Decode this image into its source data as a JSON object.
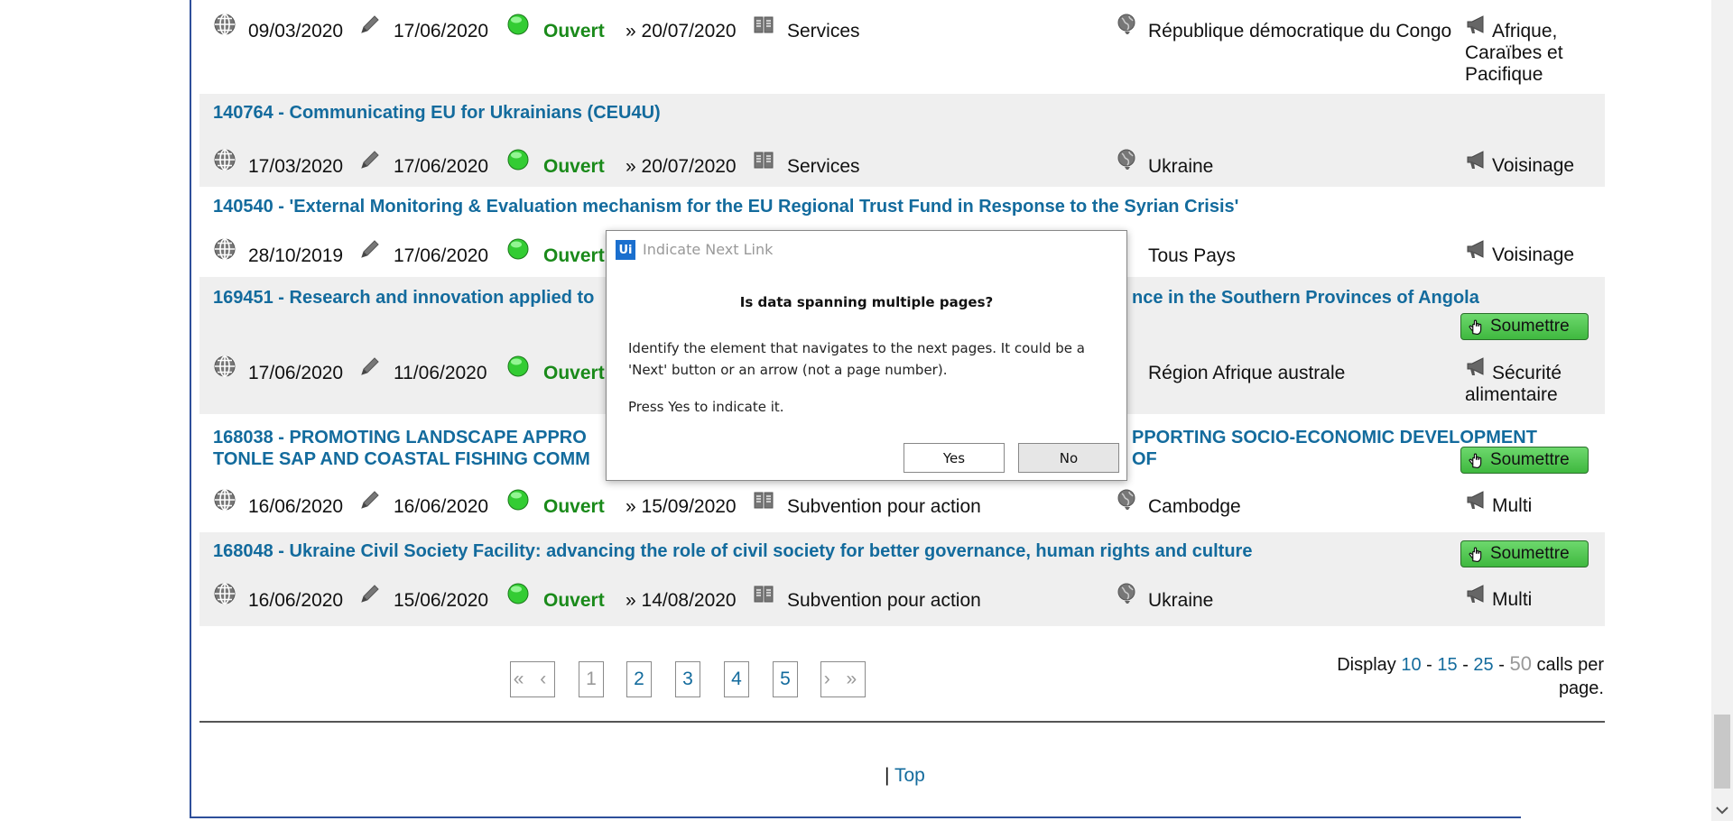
{
  "rows": [
    {
      "title": "",
      "published": "09/03/2020",
      "updated": "17/06/2020",
      "status": "Ouvert",
      "deadline": "» 20/07/2020",
      "type": "Services",
      "country": "République démocratique du Congo",
      "region": "Afrique, Caraïbes et Pacifique",
      "submit": ""
    },
    {
      "title": "140764 - Communicating EU for Ukrainians (CEU4U)",
      "published": "17/03/2020",
      "updated": "17/06/2020",
      "status": "Ouvert",
      "deadline": "» 20/07/2020",
      "type": "Services",
      "country": "Ukraine",
      "region": "Voisinage",
      "submit": ""
    },
    {
      "title": "140540 - 'External Monitoring & Evaluation mechanism for the EU Regional Trust Fund in Response to the Syrian Crisis'",
      "published": "28/10/2019",
      "updated": "17/06/2020",
      "status": "Ouvert",
      "deadline": "",
      "type": "",
      "country": "Tous Pays",
      "region": "Voisinage",
      "submit": ""
    },
    {
      "title": "169451 - Research and innovation applied to",
      "title_right": "nce in the Southern Provinces of Angola",
      "published": "17/06/2020",
      "updated": "11/06/2020",
      "status": "Ouvert",
      "deadline": "",
      "type": "",
      "country": "Région Afrique australe",
      "region": "Sécurité alimentaire",
      "submit": "Soumettre"
    },
    {
      "title": "168038 - PROMOTING LANDSCAPE APPRO",
      "title_line2": "TONLE SAP AND COASTAL FISHING COMM",
      "title_right": "PPORTING SOCIO-ECONOMIC DEVELOPMENT OF",
      "published": "16/06/2020",
      "updated": "16/06/2020",
      "status": "Ouvert",
      "deadline": "» 15/09/2020",
      "type": "Subvention pour action",
      "country": "Cambodge",
      "region": "Multi",
      "submit": "Soumettre"
    },
    {
      "title": "168048 - Ukraine Civil Society Facility: advancing the role of civil society for better governance, human rights and culture",
      "published": "16/06/2020",
      "updated": "15/06/2020",
      "status": "Ouvert",
      "deadline": "» 14/08/2020",
      "type": "Subvention pour action",
      "country": "Ukraine",
      "region": "Multi",
      "submit": "Soumettre"
    }
  ],
  "pager": {
    "first_prev": "« ‹",
    "pages": [
      "1",
      "2",
      "3",
      "4",
      "5"
    ],
    "current": "1",
    "next_last": "› »"
  },
  "display": {
    "prefix": "Display",
    "options": [
      "10",
      "15",
      "25",
      "50"
    ],
    "current": "50",
    "separator": "-",
    "suffix": "calls per page."
  },
  "footer": {
    "sep": "|",
    "top": "Top"
  },
  "dialog": {
    "logo": "Ui",
    "title": "Indicate Next Link",
    "question": "Is data spanning multiple pages?",
    "body": "Identify the element that navigates to the next pages. It could be a 'Next' button or an arrow (not a page number).",
    "body2": "Press Yes to indicate it.",
    "yes": "Yes",
    "no": "No"
  },
  "colors": {
    "link": "#136b9d",
    "open": "#1a8a1a",
    "submit": "#3fb83f",
    "frame": "#2e4f9a"
  }
}
